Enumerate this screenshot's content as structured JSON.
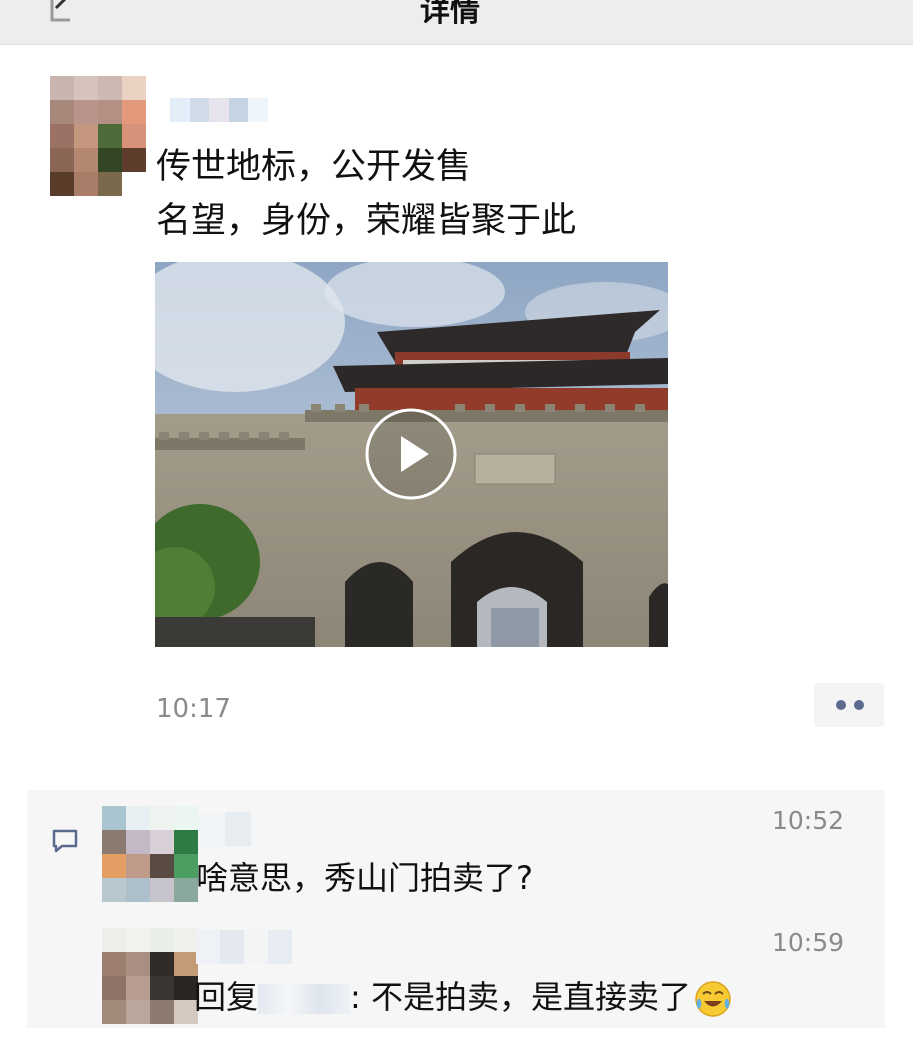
{
  "header": {
    "title": "详情",
    "back_icon": "chevron-left-icon"
  },
  "post": {
    "lines": [
      "传世地标，公开发售",
      "名望，身份，荣耀皆聚于此"
    ],
    "time": "10:17",
    "video": {
      "play_icon": "play-icon",
      "subject": "city-gate"
    },
    "more_icon": "more-dots-icon"
  },
  "comments": [
    {
      "text": "啥意思，秀山门拍卖了?",
      "time": "10:52"
    },
    {
      "reply_prefix": "回复",
      "text": ": 不是拍卖，是直接卖了",
      "time": "10:59",
      "emoji": "laughing-tears-icon"
    }
  ],
  "colors": {
    "topbar": "#ededed",
    "comment_bg": "#f6f6f6",
    "link": "#5b6b8d",
    "time": "#8a8a8a"
  }
}
